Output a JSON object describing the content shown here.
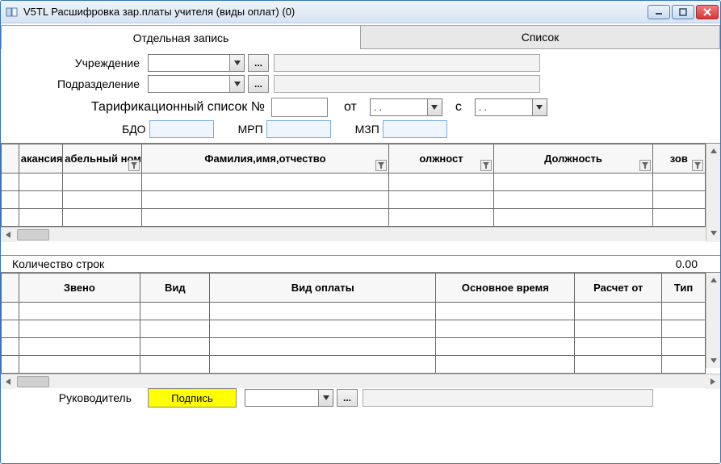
{
  "window": {
    "title": "V5TL Расшифровка зар.платы учителя (виды оплат) (0)"
  },
  "tabs": {
    "record": "Отдельная запись",
    "list": "Список"
  },
  "labels": {
    "institution": "Учреждение",
    "department": "Подразделение",
    "tariff_list": "Тарификационный список №",
    "from": "от",
    "from_date_value": ". .",
    "since": "с",
    "since_date_value": ". .",
    "bdo": "БДО",
    "mrp": "МРП",
    "mzp": "МЗП",
    "row_count": "Количество строк",
    "row_count_value": "0.00",
    "manager": "Руководитель",
    "sign": "Подпись",
    "dots": "..."
  },
  "grid1": {
    "cols": {
      "vacancy": "акансия",
      "tabno": "абельный номер",
      "fio": "Фамилия,имя,отчество",
      "position_short": "олжност",
      "position": "Должность",
      "suffix": "зов"
    }
  },
  "grid2": {
    "cols": {
      "link": "Звено",
      "kind": "Вид",
      "paytype": "Вид оплаты",
      "maintime": "Основное время",
      "calc_from": "Расчет от",
      "type": "Тип"
    }
  }
}
